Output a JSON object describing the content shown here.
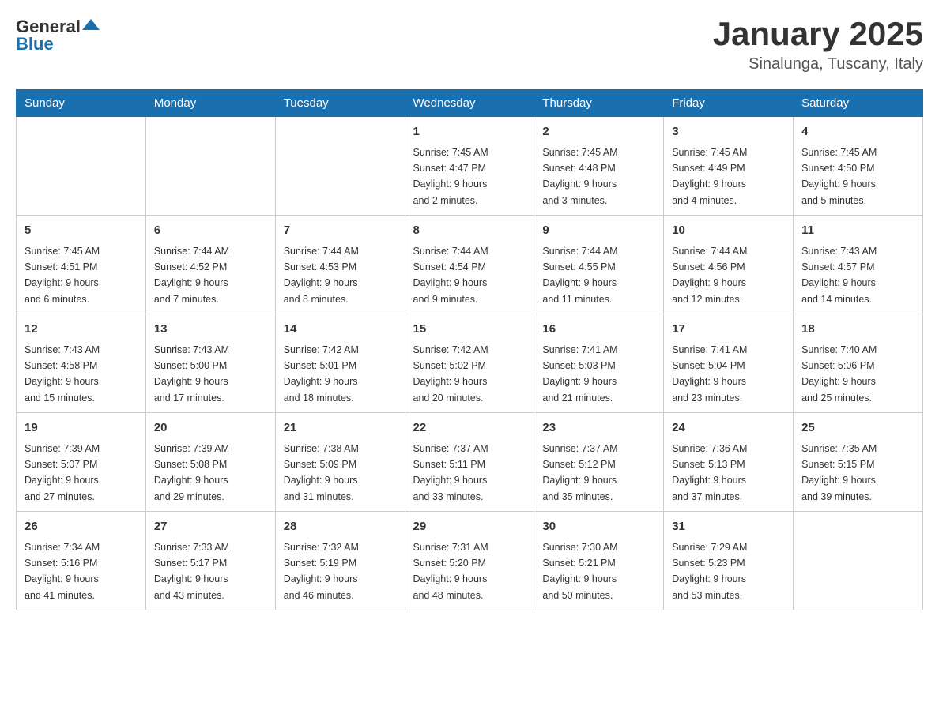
{
  "header": {
    "logo_general": "General",
    "logo_blue": "Blue",
    "month": "January 2025",
    "location": "Sinalunga, Tuscany, Italy"
  },
  "days_of_week": [
    "Sunday",
    "Monday",
    "Tuesday",
    "Wednesday",
    "Thursday",
    "Friday",
    "Saturday"
  ],
  "weeks": [
    [
      {
        "day": "",
        "info": ""
      },
      {
        "day": "",
        "info": ""
      },
      {
        "day": "",
        "info": ""
      },
      {
        "day": "1",
        "info": "Sunrise: 7:45 AM\nSunset: 4:47 PM\nDaylight: 9 hours\nand 2 minutes."
      },
      {
        "day": "2",
        "info": "Sunrise: 7:45 AM\nSunset: 4:48 PM\nDaylight: 9 hours\nand 3 minutes."
      },
      {
        "day": "3",
        "info": "Sunrise: 7:45 AM\nSunset: 4:49 PM\nDaylight: 9 hours\nand 4 minutes."
      },
      {
        "day": "4",
        "info": "Sunrise: 7:45 AM\nSunset: 4:50 PM\nDaylight: 9 hours\nand 5 minutes."
      }
    ],
    [
      {
        "day": "5",
        "info": "Sunrise: 7:45 AM\nSunset: 4:51 PM\nDaylight: 9 hours\nand 6 minutes."
      },
      {
        "day": "6",
        "info": "Sunrise: 7:44 AM\nSunset: 4:52 PM\nDaylight: 9 hours\nand 7 minutes."
      },
      {
        "day": "7",
        "info": "Sunrise: 7:44 AM\nSunset: 4:53 PM\nDaylight: 9 hours\nand 8 minutes."
      },
      {
        "day": "8",
        "info": "Sunrise: 7:44 AM\nSunset: 4:54 PM\nDaylight: 9 hours\nand 9 minutes."
      },
      {
        "day": "9",
        "info": "Sunrise: 7:44 AM\nSunset: 4:55 PM\nDaylight: 9 hours\nand 11 minutes."
      },
      {
        "day": "10",
        "info": "Sunrise: 7:44 AM\nSunset: 4:56 PM\nDaylight: 9 hours\nand 12 minutes."
      },
      {
        "day": "11",
        "info": "Sunrise: 7:43 AM\nSunset: 4:57 PM\nDaylight: 9 hours\nand 14 minutes."
      }
    ],
    [
      {
        "day": "12",
        "info": "Sunrise: 7:43 AM\nSunset: 4:58 PM\nDaylight: 9 hours\nand 15 minutes."
      },
      {
        "day": "13",
        "info": "Sunrise: 7:43 AM\nSunset: 5:00 PM\nDaylight: 9 hours\nand 17 minutes."
      },
      {
        "day": "14",
        "info": "Sunrise: 7:42 AM\nSunset: 5:01 PM\nDaylight: 9 hours\nand 18 minutes."
      },
      {
        "day": "15",
        "info": "Sunrise: 7:42 AM\nSunset: 5:02 PM\nDaylight: 9 hours\nand 20 minutes."
      },
      {
        "day": "16",
        "info": "Sunrise: 7:41 AM\nSunset: 5:03 PM\nDaylight: 9 hours\nand 21 minutes."
      },
      {
        "day": "17",
        "info": "Sunrise: 7:41 AM\nSunset: 5:04 PM\nDaylight: 9 hours\nand 23 minutes."
      },
      {
        "day": "18",
        "info": "Sunrise: 7:40 AM\nSunset: 5:06 PM\nDaylight: 9 hours\nand 25 minutes."
      }
    ],
    [
      {
        "day": "19",
        "info": "Sunrise: 7:39 AM\nSunset: 5:07 PM\nDaylight: 9 hours\nand 27 minutes."
      },
      {
        "day": "20",
        "info": "Sunrise: 7:39 AM\nSunset: 5:08 PM\nDaylight: 9 hours\nand 29 minutes."
      },
      {
        "day": "21",
        "info": "Sunrise: 7:38 AM\nSunset: 5:09 PM\nDaylight: 9 hours\nand 31 minutes."
      },
      {
        "day": "22",
        "info": "Sunrise: 7:37 AM\nSunset: 5:11 PM\nDaylight: 9 hours\nand 33 minutes."
      },
      {
        "day": "23",
        "info": "Sunrise: 7:37 AM\nSunset: 5:12 PM\nDaylight: 9 hours\nand 35 minutes."
      },
      {
        "day": "24",
        "info": "Sunrise: 7:36 AM\nSunset: 5:13 PM\nDaylight: 9 hours\nand 37 minutes."
      },
      {
        "day": "25",
        "info": "Sunrise: 7:35 AM\nSunset: 5:15 PM\nDaylight: 9 hours\nand 39 minutes."
      }
    ],
    [
      {
        "day": "26",
        "info": "Sunrise: 7:34 AM\nSunset: 5:16 PM\nDaylight: 9 hours\nand 41 minutes."
      },
      {
        "day": "27",
        "info": "Sunrise: 7:33 AM\nSunset: 5:17 PM\nDaylight: 9 hours\nand 43 minutes."
      },
      {
        "day": "28",
        "info": "Sunrise: 7:32 AM\nSunset: 5:19 PM\nDaylight: 9 hours\nand 46 minutes."
      },
      {
        "day": "29",
        "info": "Sunrise: 7:31 AM\nSunset: 5:20 PM\nDaylight: 9 hours\nand 48 minutes."
      },
      {
        "day": "30",
        "info": "Sunrise: 7:30 AM\nSunset: 5:21 PM\nDaylight: 9 hours\nand 50 minutes."
      },
      {
        "day": "31",
        "info": "Sunrise: 7:29 AM\nSunset: 5:23 PM\nDaylight: 9 hours\nand 53 minutes."
      },
      {
        "day": "",
        "info": ""
      }
    ]
  ]
}
